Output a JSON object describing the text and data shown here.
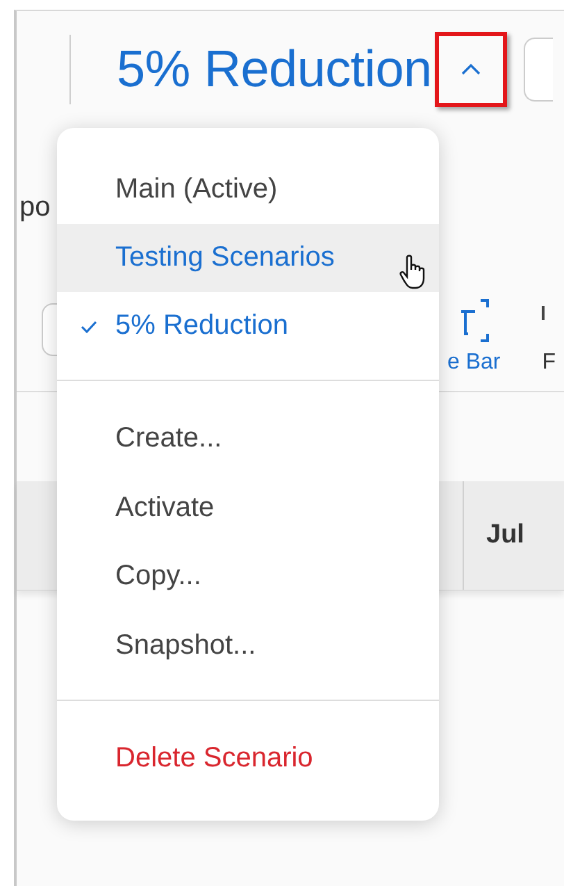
{
  "header": {
    "title": "5% Reduction",
    "menu_open": true
  },
  "section_label": "po",
  "toolbar": [
    {
      "kind": "icon-button",
      "label": "e Bar"
    },
    {
      "kind": "text",
      "label": "F"
    }
  ],
  "table": {
    "columns": [
      "Jul"
    ]
  },
  "menu": {
    "scenarios": [
      {
        "label": "Main (Active)",
        "selected": false,
        "hovered": false
      },
      {
        "label": "Testing Scenarios",
        "selected": false,
        "hovered": true
      },
      {
        "label": "5% Reduction",
        "selected": true,
        "hovered": false
      }
    ],
    "actions": [
      "Create...",
      "Activate",
      "Copy...",
      "Snapshot..."
    ],
    "danger_actions": [
      "Delete Scenario"
    ]
  }
}
